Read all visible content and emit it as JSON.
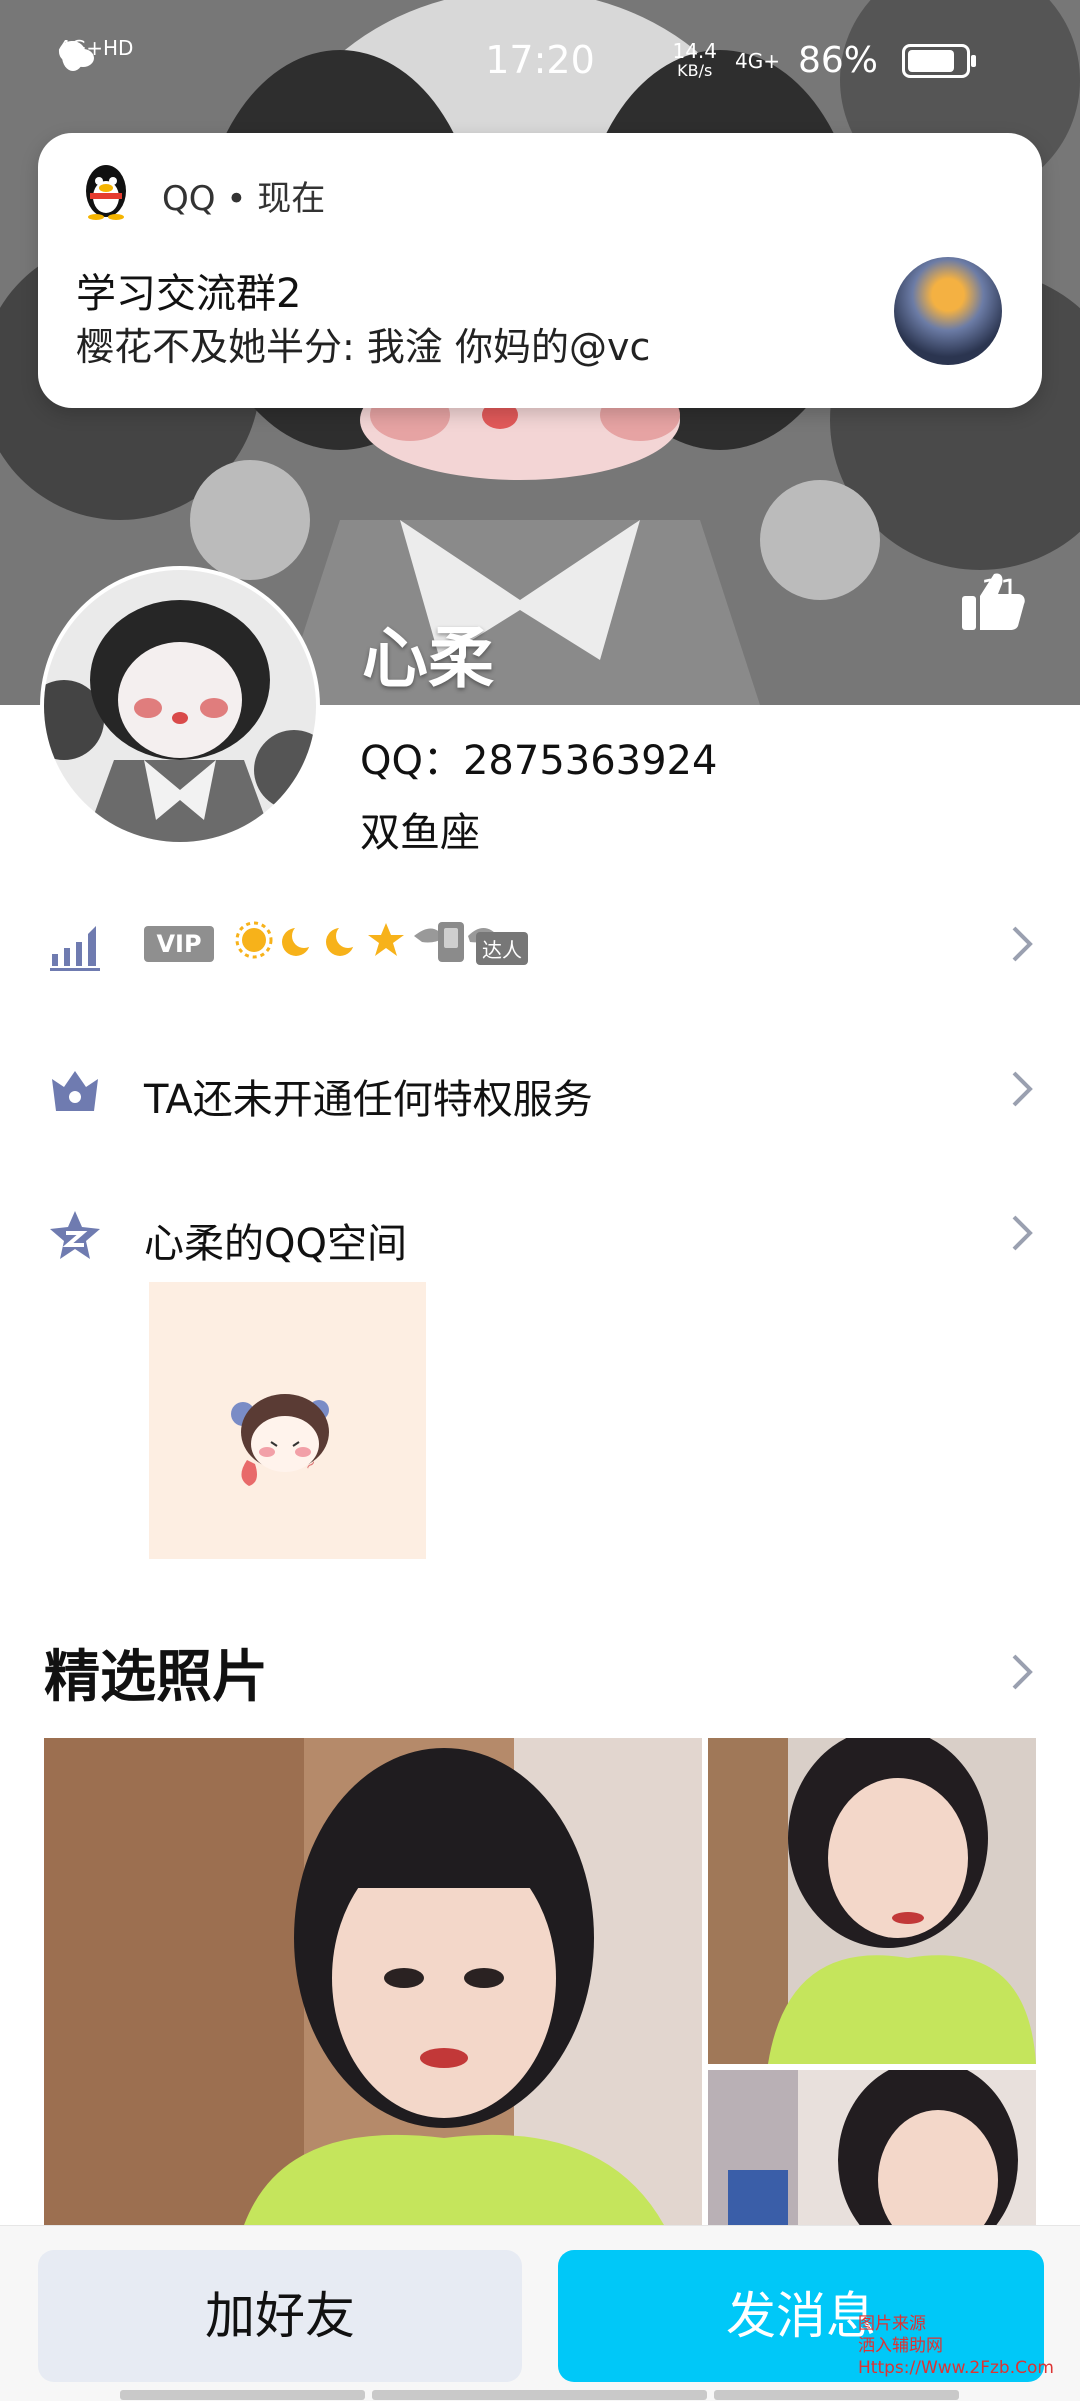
{
  "status_bar": {
    "network_left": "4G+HD",
    "time": "17:20",
    "speed_value": "14.4",
    "speed_unit": "KB/s",
    "network_right": "4G+",
    "battery": "86%",
    "battery_level": 0.86
  },
  "notification": {
    "app": "QQ",
    "separator": "•",
    "when": "现在",
    "title": "学习交流群2",
    "body": "樱花不及她半分: 我淦 你妈的@vc"
  },
  "profile": {
    "nickname": "心柔",
    "likes": "11",
    "qq_label": "QQ：2875363924",
    "zodiac": "双鱼座"
  },
  "rows": {
    "vip_tag": "VIP",
    "daren_label": "达人",
    "privilege_text": "TA还未开通任何特权服务",
    "qzone_text": "心柔的QQ空间"
  },
  "photos": {
    "section_title": "精选照片"
  },
  "actions": {
    "add_friend": "加好友",
    "send_message": "发消息"
  },
  "watermark": {
    "line1": "图片来源",
    "line2": "洒入辅助网",
    "line3": "Https://Www.2Fzb.Com"
  },
  "colors": {
    "primary_button": "#00c8f8",
    "secondary_button": "#e7ebf3"
  }
}
